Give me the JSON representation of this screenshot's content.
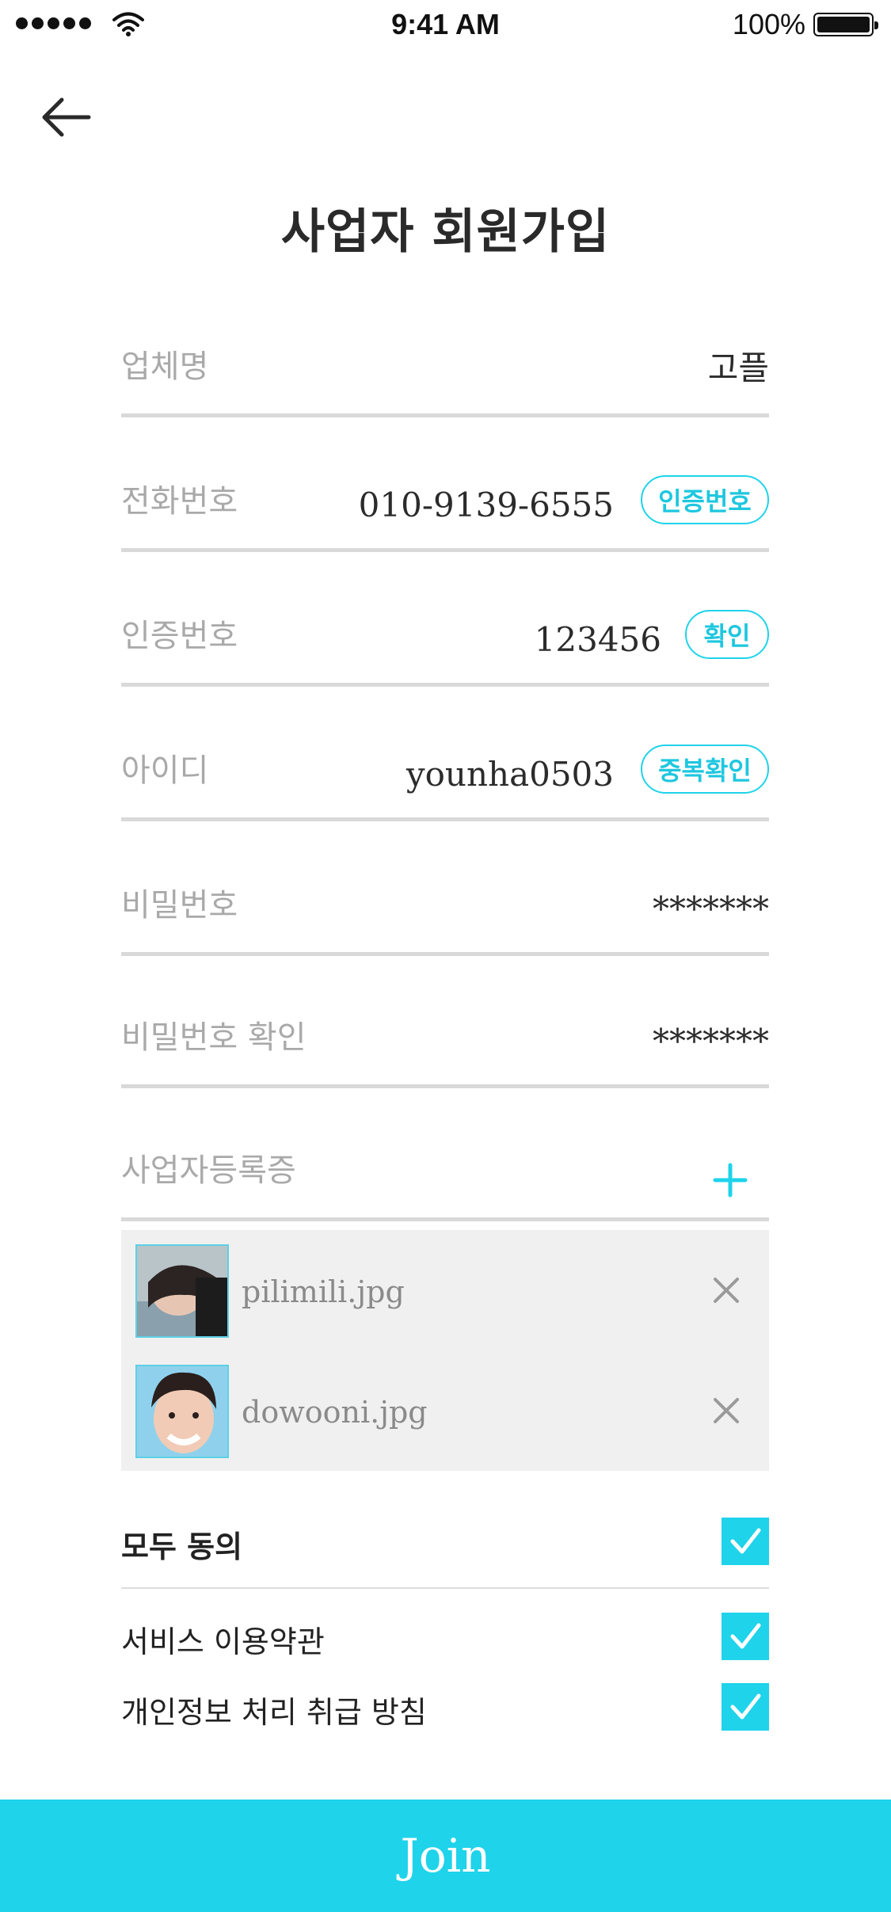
{
  "status_bar": {
    "time": "9:41 AM",
    "battery": "100%"
  },
  "header": {
    "title": "사업자 회원가입"
  },
  "form": {
    "company": {
      "label": "업체명",
      "value": "고플"
    },
    "phone": {
      "label": "전화번호",
      "value": "010-9139-6555",
      "button": "인증번호"
    },
    "code": {
      "label": "인증번호",
      "value": "123456",
      "button": "확인"
    },
    "user_id": {
      "label": "아이디",
      "value": "younha0503",
      "button": "중복확인"
    },
    "password": {
      "label": "비밀번호",
      "value": "*******"
    },
    "password_confirm": {
      "label": "비밀번호 확인",
      "value": "*******"
    },
    "license": {
      "label": "사업자등록증"
    }
  },
  "attachments": [
    {
      "name": "pilimili.jpg"
    },
    {
      "name": "dowooni.jpg"
    }
  ],
  "agreements": {
    "all": {
      "label": "모두 동의",
      "checked": true
    },
    "terms": {
      "label": "서비스 이용약관",
      "checked": true
    },
    "privacy": {
      "label": "개인정보 처리 취급 방침",
      "checked": true
    }
  },
  "actions": {
    "join_label": "Join"
  },
  "colors": {
    "accent": "#1fd3ea",
    "divider": "#d9d9d9",
    "placeholder": "#a9a9a9"
  },
  "icons": [
    "signal-icon",
    "wifi-icon",
    "battery-icon",
    "back-arrow-icon",
    "plus-icon",
    "close-icon",
    "check-icon"
  ]
}
